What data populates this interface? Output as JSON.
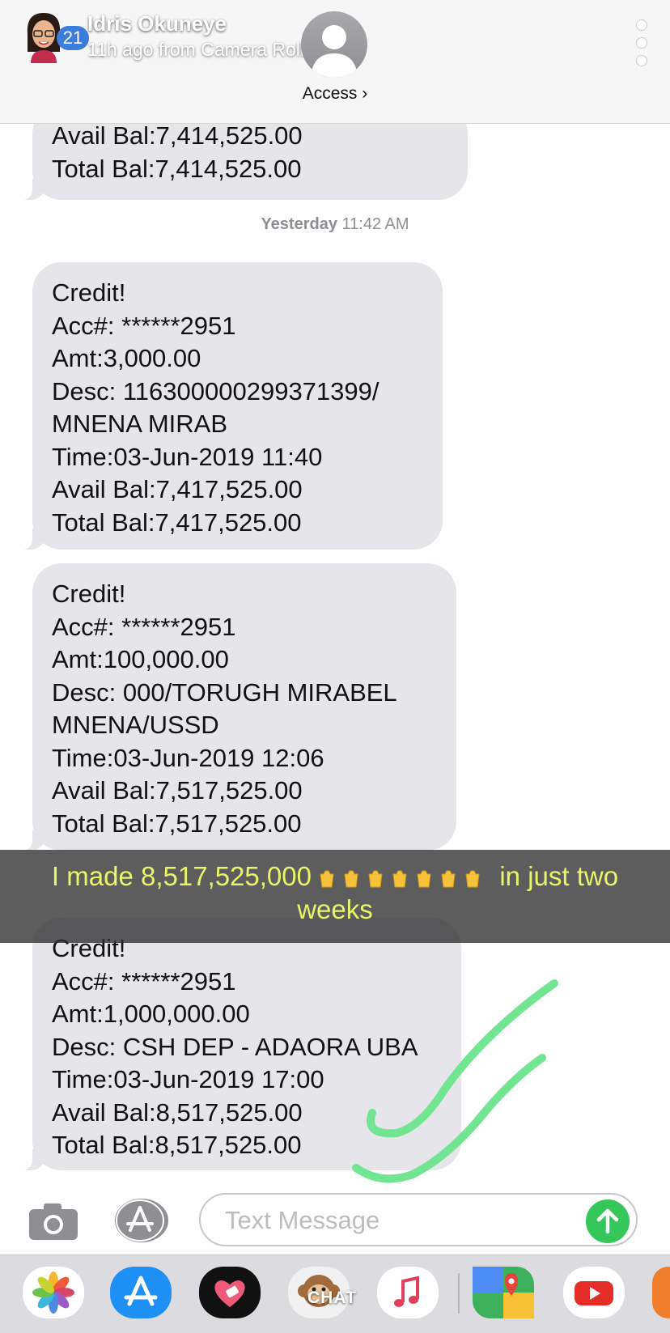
{
  "header": {
    "sender_name": "Idris Okuneye",
    "sender_meta": "11h ago from Camera Roll",
    "unread_count": "21",
    "contact_title": "Access ›"
  },
  "messages": [
    {
      "lines": [
        "Avail Bal:7,414,525.00",
        "Total Bal:7,414,525.00"
      ]
    },
    {
      "lines": [
        "Credit!",
        "Acc#: ******2951",
        "Amt:3,000.00",
        "Desc: 1163000002993713​99/",
        "MNENA MIRAB",
        "Time:03-Jun-2019 11:40",
        "Avail Bal:7,417,525.00",
        "Total Bal:7,417,525.00"
      ]
    },
    {
      "lines": [
        "Credit!",
        "Acc#: ******2951",
        "Amt:100,000.00",
        "Desc: 000/TORUGH  MIRABEL",
        "MNENA/USSD",
        "Time:03-Jun-2019 12:06",
        "Avail Bal:7,517,525.00",
        "Total Bal:7,517,525.00"
      ]
    },
    {
      "lines": [
        "Credit!",
        "Acc#: ******2951",
        "Amt:1,000,000.00",
        "Desc: CSH DEP - ADAORA UBA",
        "Time:03-Jun-2019 17:00",
        "Avail Bal:8,517,525.00",
        "Total Bal:8,517,525.00"
      ]
    }
  ],
  "timestamps": [
    {
      "day": "Yesterday",
      "time": "11:42 AM"
    }
  ],
  "caption": {
    "before": "I made 8,517,525,000 ",
    "after": " in just two weeks",
    "color": "#e8f46a"
  },
  "input": {
    "placeholder": "Text Message"
  },
  "dock": {
    "chat_label": "CHAT",
    "apps": [
      "photos-app-icon",
      "app-store-icon",
      "heart-app-icon",
      "monkey-app-icon",
      "music-app-icon",
      "maps-app-icon",
      "youtube-app-icon"
    ]
  },
  "colors": {
    "bubble": "#e5e5ea",
    "send": "#35c759",
    "check_marks": "#72e592"
  }
}
